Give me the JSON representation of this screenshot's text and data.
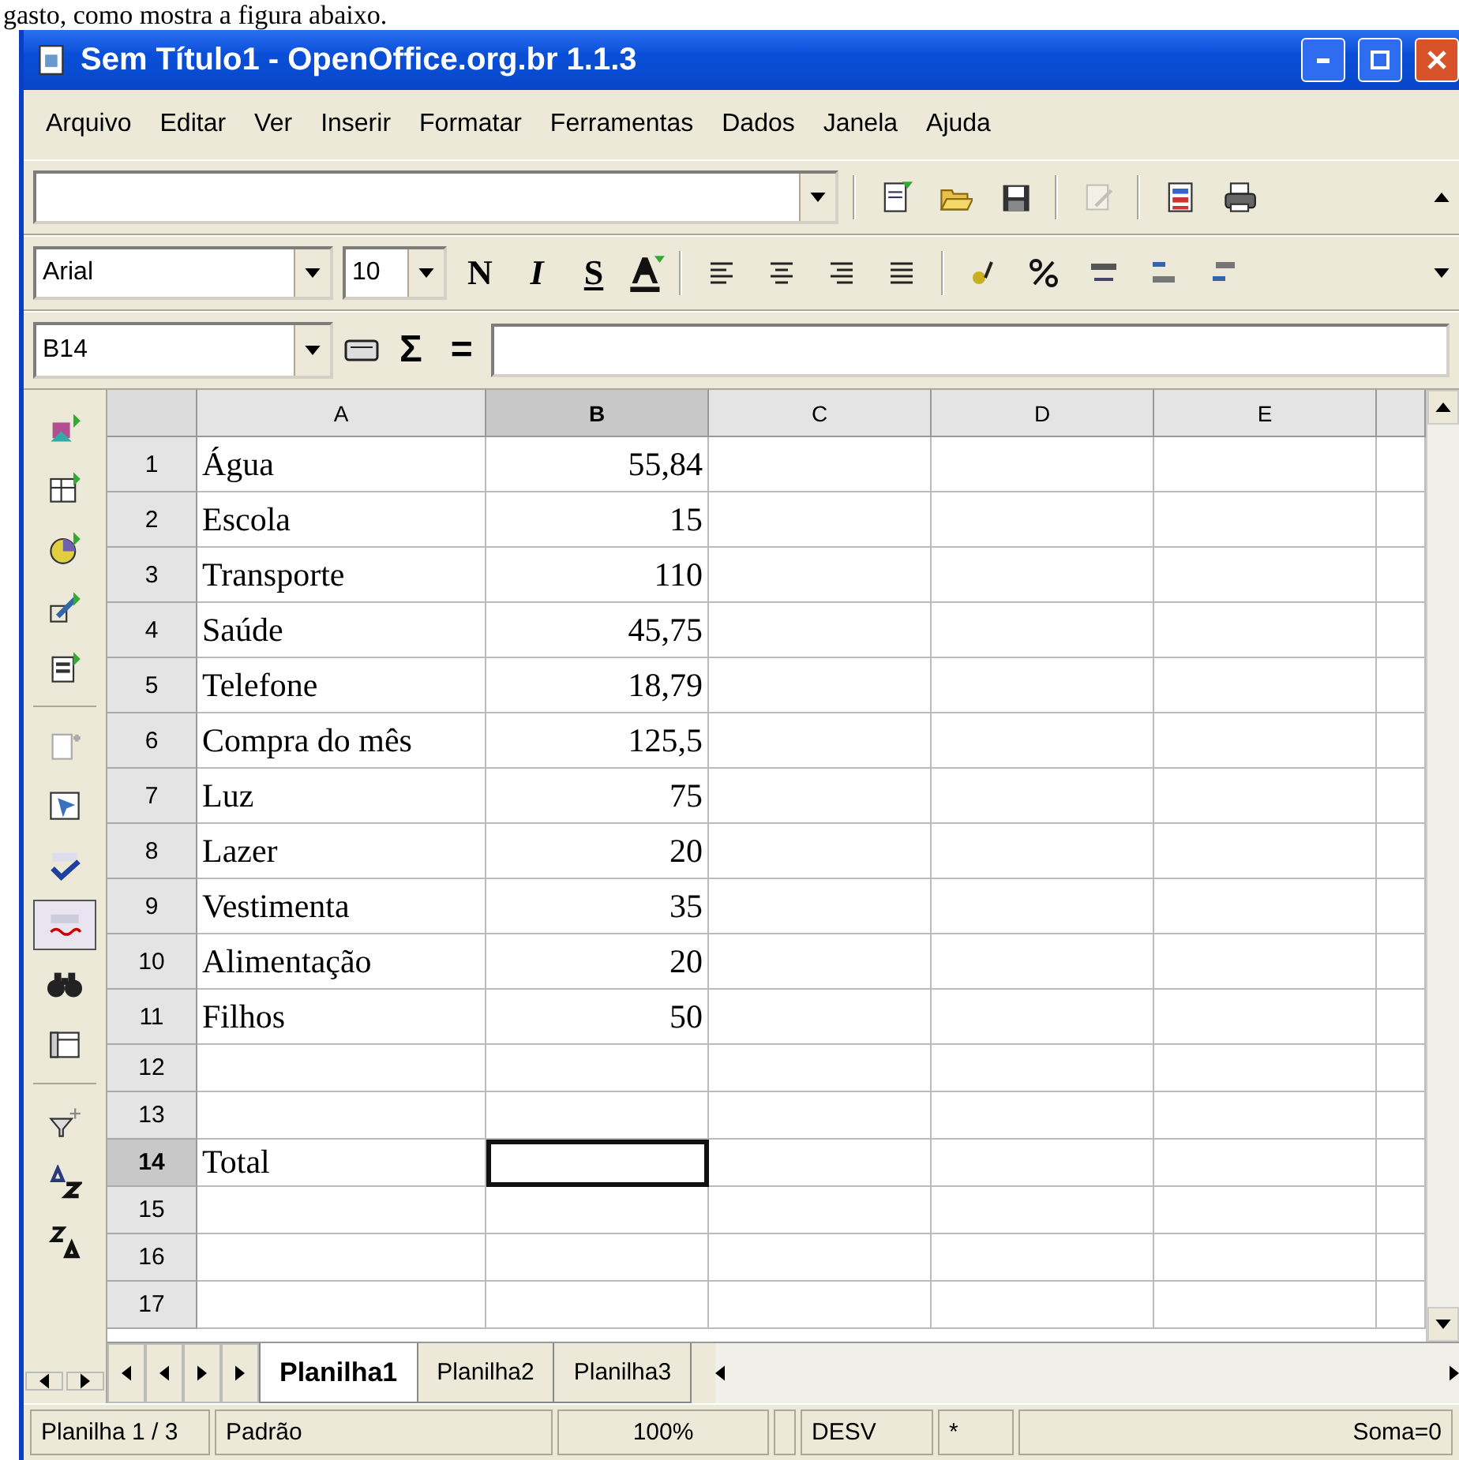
{
  "caption": "gasto, como mostra a figura abaixo.",
  "window": {
    "title": "Sem Título1 - OpenOffice.org.br 1.1.3"
  },
  "menu": [
    "Arquivo",
    "Editar",
    "Ver",
    "Inserir",
    "Formatar",
    "Ferramentas",
    "Dados",
    "Janela",
    "Ajuda"
  ],
  "function_bar": {
    "tools": [
      {
        "kind": "new",
        "disabled": false
      },
      {
        "kind": "open",
        "disabled": false
      },
      {
        "kind": "save",
        "disabled": false
      },
      {
        "kind": "edit",
        "disabled": true
      },
      {
        "kind": "pdf",
        "disabled": false
      },
      {
        "kind": "print",
        "disabled": false
      }
    ]
  },
  "format_bar": {
    "font": "Arial",
    "size": "10",
    "styles": [
      "N",
      "I",
      "S"
    ]
  },
  "formula_bar": {
    "cell_ref": "B14",
    "sum": "Σ",
    "equals": "="
  },
  "side_tools": [
    {
      "kind": "insert",
      "pressed": false
    },
    {
      "kind": "table",
      "pressed": false
    },
    {
      "kind": "chart",
      "pressed": false
    },
    {
      "kind": "draw",
      "pressed": false
    },
    {
      "kind": "form",
      "pressed": false
    },
    {
      "kind": "sep"
    },
    {
      "kind": "row",
      "pressed": false
    },
    {
      "kind": "navigator",
      "pressed": false
    },
    {
      "kind": "spell",
      "pressed": false
    },
    {
      "kind": "autospell",
      "pressed": true
    },
    {
      "kind": "find",
      "pressed": false
    },
    {
      "kind": "datasource",
      "pressed": false
    },
    {
      "kind": "sep"
    },
    {
      "kind": "filter",
      "pressed": false
    },
    {
      "kind": "sortaz",
      "pressed": false
    },
    {
      "kind": "sortza",
      "pressed": false
    }
  ],
  "columns": [
    {
      "label": "A",
      "selected": false
    },
    {
      "label": "B",
      "selected": true
    },
    {
      "label": "C",
      "selected": false
    },
    {
      "label": "D",
      "selected": false
    },
    {
      "label": "E",
      "selected": false
    }
  ],
  "rows": [
    {
      "number": "1",
      "a": "Água",
      "b": "55,84",
      "selected": false
    },
    {
      "number": "2",
      "a": "Escola",
      "b": "15",
      "selected": false
    },
    {
      "number": "3",
      "a": "Transporte",
      "b": "110",
      "selected": false
    },
    {
      "number": "4",
      "a": "Saúde",
      "b": "45,75",
      "selected": false
    },
    {
      "number": "5",
      "a": "Telefone",
      "b": "18,79",
      "selected": false
    },
    {
      "number": "6",
      "a": "Compra do mês",
      "b": "125,5",
      "selected": false
    },
    {
      "number": "7",
      "a": "Luz",
      "b": "75",
      "selected": false
    },
    {
      "number": "8",
      "a": "Lazer",
      "b": "20",
      "selected": false
    },
    {
      "number": "9",
      "a": "Vestimenta",
      "b": "35",
      "selected": false
    },
    {
      "number": "10",
      "a": "Alimentação",
      "b": "20",
      "selected": false
    },
    {
      "number": "11",
      "a": "Filhos",
      "b": "50",
      "selected": false
    },
    {
      "number": "12",
      "selected": false
    },
    {
      "number": "13",
      "selected": false
    },
    {
      "number": "14",
      "a": "Total",
      "selected": true
    },
    {
      "number": "15",
      "selected": false
    },
    {
      "number": "16",
      "selected": false
    },
    {
      "number": "17",
      "selected": false
    }
  ],
  "sheet_tabs": [
    {
      "label": "Planilha1",
      "selected": true
    },
    {
      "label": "Planilha2",
      "selected": false
    },
    {
      "label": "Planilha3",
      "selected": false
    }
  ],
  "status_bar": [
    "Planilha 1 / 3",
    "Padrão",
    "100%",
    "DESV",
    "*",
    "Soma=0"
  ]
}
